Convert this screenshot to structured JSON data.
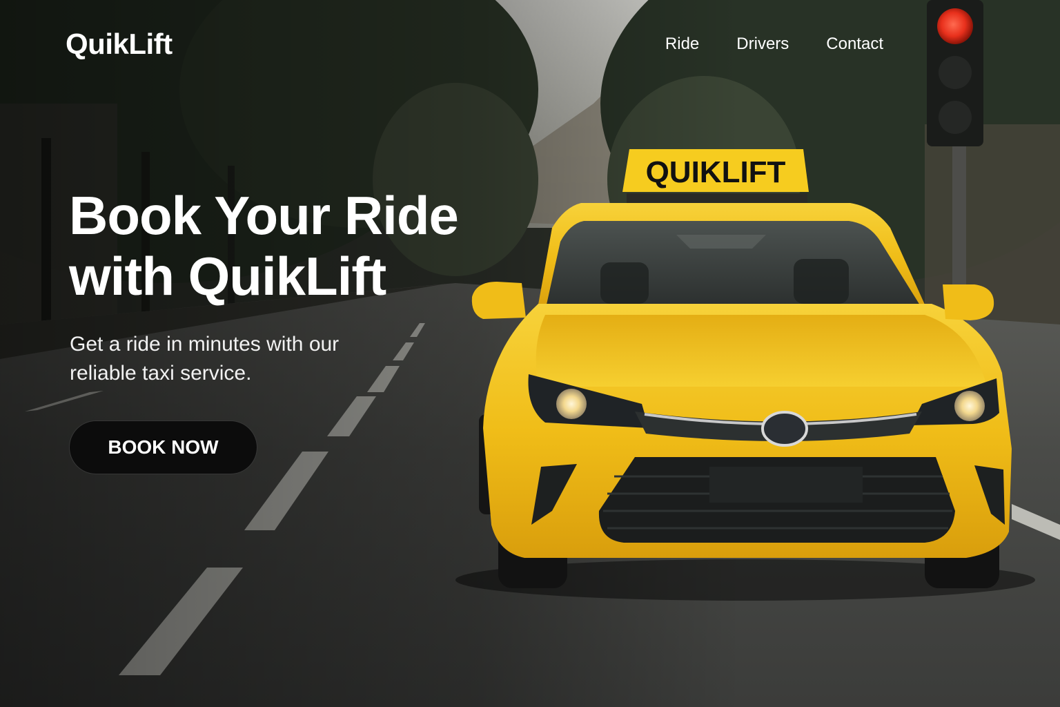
{
  "brand": {
    "name": "QuikLift"
  },
  "nav": {
    "items": [
      {
        "label": "Ride"
      },
      {
        "label": "Drivers"
      },
      {
        "label": "Contact"
      }
    ]
  },
  "hero": {
    "headline_line1": "Book Your Ride",
    "headline_line2": "with QuikLift",
    "subtitle_line1": "Get a ride in minutes with our",
    "subtitle_line2": "reliable taxi service.",
    "cta_label": "BOOK NOW",
    "taxi_sign_text": "QUIKLIFT"
  },
  "colors": {
    "taxi_yellow": "#f3c11c",
    "cta_background": "#0c0c0c",
    "text": "#ffffff",
    "signal_red": "#e8301c"
  },
  "icons": {
    "traffic_light": "traffic-light-icon"
  }
}
